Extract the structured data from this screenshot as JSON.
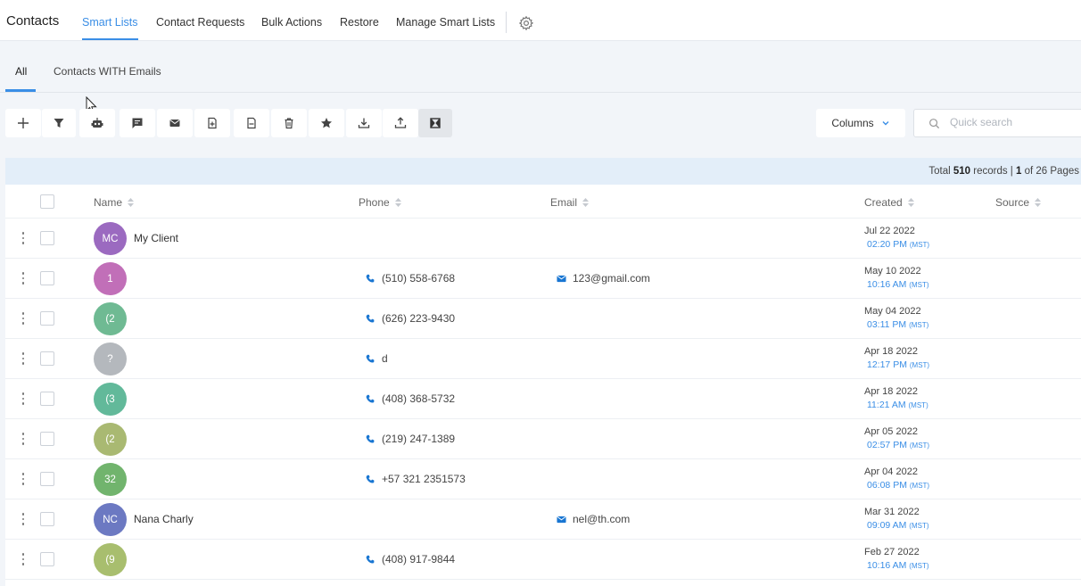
{
  "header": {
    "title": "Contacts",
    "tabs": [
      {
        "label": "Smart Lists",
        "active": true
      },
      {
        "label": "Contact Requests",
        "active": false
      },
      {
        "label": "Bulk Actions",
        "active": false
      },
      {
        "label": "Restore",
        "active": false
      },
      {
        "label": "Manage Smart Lists",
        "active": false
      }
    ],
    "settings_icon": "gear-icon"
  },
  "subtabs": [
    {
      "label": "All",
      "active": true
    },
    {
      "label": "Contacts WITH Emails",
      "active": false
    }
  ],
  "toolbar": {
    "buttons": [
      "add-icon",
      "filter-icon",
      "robot-icon",
      "sms-icon",
      "email-icon",
      "add-tag-icon",
      "remove-tag-icon",
      "delete-icon",
      "star-icon",
      "import-icon",
      "export-icon",
      "merge-icon"
    ],
    "columns_label": "Columns",
    "search_placeholder": "Quick search"
  },
  "records": {
    "prefix": "Total",
    "total": "510",
    "middle": "records |",
    "page": "1",
    "of_text": "of 26 Pages"
  },
  "table": {
    "columns": [
      "Name",
      "Phone",
      "Email",
      "Created",
      "Source"
    ],
    "rows": [
      {
        "initials": "MC",
        "avatar_color": "#9b6ac0",
        "name": "My Client",
        "phone": "",
        "email": "",
        "date": "Jul 22 2022",
        "time": "02:20 PM",
        "tz": "(MST)"
      },
      {
        "initials": "1",
        "avatar_color": "#c16fb8",
        "name": "",
        "phone": "(510) 558-6768",
        "email": "123@gmail.com",
        "date": "May 10 2022",
        "time": "10:16 AM",
        "tz": "(MST)"
      },
      {
        "initials": "(2",
        "avatar_color": "#6fba93",
        "name": "",
        "phone": "(626) 223-9430",
        "email": "",
        "date": "May 04 2022",
        "time": "03:11 PM",
        "tz": "(MST)"
      },
      {
        "initials": "?",
        "avatar_color": "#b4b8bd",
        "name": "",
        "phone": "d",
        "email": "",
        "date": "Apr 18 2022",
        "time": "12:17 PM",
        "tz": "(MST)"
      },
      {
        "initials": "(3",
        "avatar_color": "#62b99a",
        "name": "",
        "phone": "(408) 368-5732",
        "email": "",
        "date": "Apr 18 2022",
        "time": "11:21 AM",
        "tz": "(MST)"
      },
      {
        "initials": "(2",
        "avatar_color": "#a9b972",
        "name": "",
        "phone": "(219) 247-1389",
        "email": "",
        "date": "Apr 05 2022",
        "time": "02:57 PM",
        "tz": "(MST)"
      },
      {
        "initials": "32",
        "avatar_color": "#71b46d",
        "name": "",
        "phone": "+57 321 2351573",
        "email": "",
        "date": "Apr 04 2022",
        "time": "06:08 PM",
        "tz": "(MST)"
      },
      {
        "initials": "NC",
        "avatar_color": "#6c79c2",
        "name": "Nana Charly",
        "phone": "",
        "email": "nel@th.com",
        "date": "Mar 31 2022",
        "time": "09:09 AM",
        "tz": "(MST)"
      },
      {
        "initials": "(9",
        "avatar_color": "#a8be6e",
        "name": "",
        "phone": "(408) 917-9844",
        "email": "",
        "date": "Feb 27 2022",
        "time": "10:16 AM",
        "tz": "(MST)"
      }
    ]
  },
  "colors": {
    "accent": "#3a8ee6",
    "records_bar": "#e3eef9"
  }
}
